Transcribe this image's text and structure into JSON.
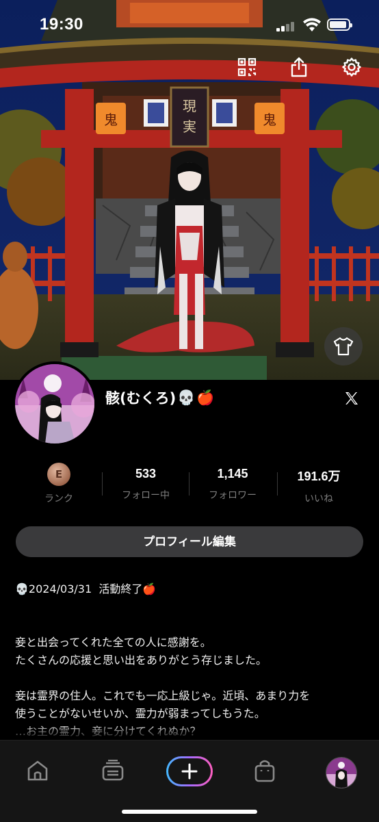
{
  "status_bar": {
    "time": "19:30"
  },
  "hero": {
    "plaque_text": "現実",
    "lantern_text": "鬼",
    "icons": [
      "qr-code-icon",
      "share-icon",
      "gear-icon",
      "shirt-icon"
    ]
  },
  "profile": {
    "name": "骸(むくろ)",
    "name_emoji_1": "💀",
    "name_emoji_2": "🍎"
  },
  "stats": [
    {
      "value": "533",
      "label": "フォロー中"
    },
    {
      "value": "1,145",
      "label": "フォロワー"
    },
    {
      "value": "191.6万",
      "label": "いいね"
    }
  ],
  "rank": {
    "badge_letter": "E",
    "label": "ランク"
  },
  "edit_button_label": "プロフィール編集",
  "bio": {
    "emoji_start": "💀",
    "date_line": "2024/03/31  活動終了",
    "emoji_end": "🍎",
    "paragraph_1": "妾と出会ってくれた全ての人に感謝を。\nたくさんの応援と思い出をありがとう存じました。",
    "paragraph_2": "妾は霊界の住人。これでも一応上級じゃ。近頃、あまり力を\n使うことがないせいか、霊力が弱まってしもうた。\n…お主の霊力、妾に分けてくれぬか？"
  },
  "tabbar": {
    "items": [
      "home-icon",
      "feed-icon",
      "plus-icon",
      "bag-icon",
      "profile-avatar"
    ]
  },
  "colors": {
    "background": "#000000",
    "button_bg": "#3a3a3c",
    "muted_text": "#7d7d7d",
    "torii_red": "#b3261e",
    "plus_gradient": [
      "#43b9ff",
      "#a46bff",
      "#ff5fbf"
    ]
  }
}
